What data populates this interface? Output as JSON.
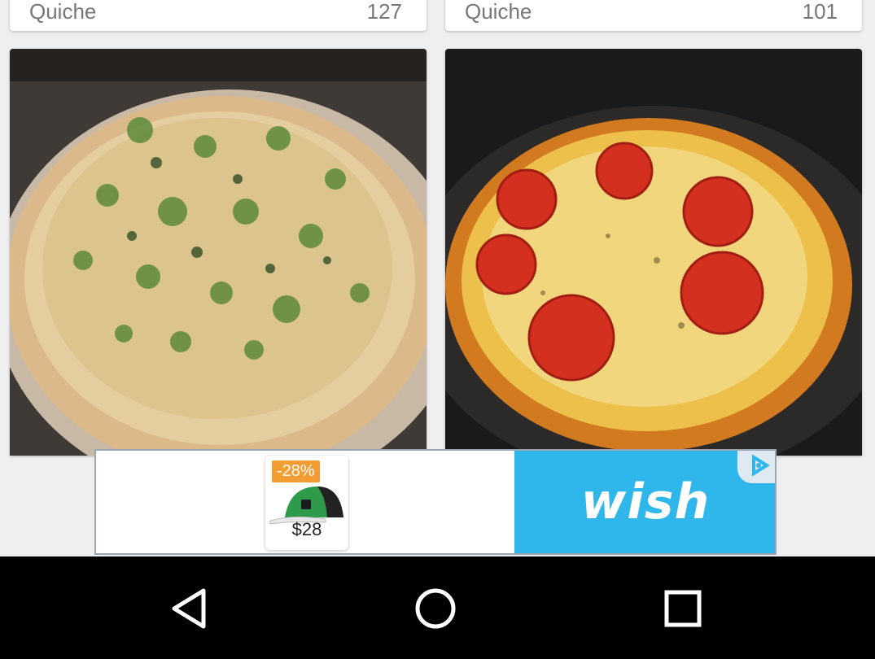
{
  "cards_top": [
    {
      "title": "Quiche",
      "count": "127"
    },
    {
      "title": "Quiche",
      "count": "101"
    }
  ],
  "recipes": [
    {
      "image": "broccoli-asparagus-quiche-photo"
    },
    {
      "image": "tomato-cheese-quiche-photo"
    }
  ],
  "ad": {
    "discount": "-28%",
    "price": "$28",
    "product_icon": "cap-icon",
    "brand": "wish",
    "brand_color": "#2fb7ec",
    "adchoices_icon": "adchoices-icon"
  },
  "navbar": {
    "back_icon": "back-triangle-icon",
    "home_icon": "home-circle-icon",
    "recents_icon": "recents-square-icon"
  }
}
